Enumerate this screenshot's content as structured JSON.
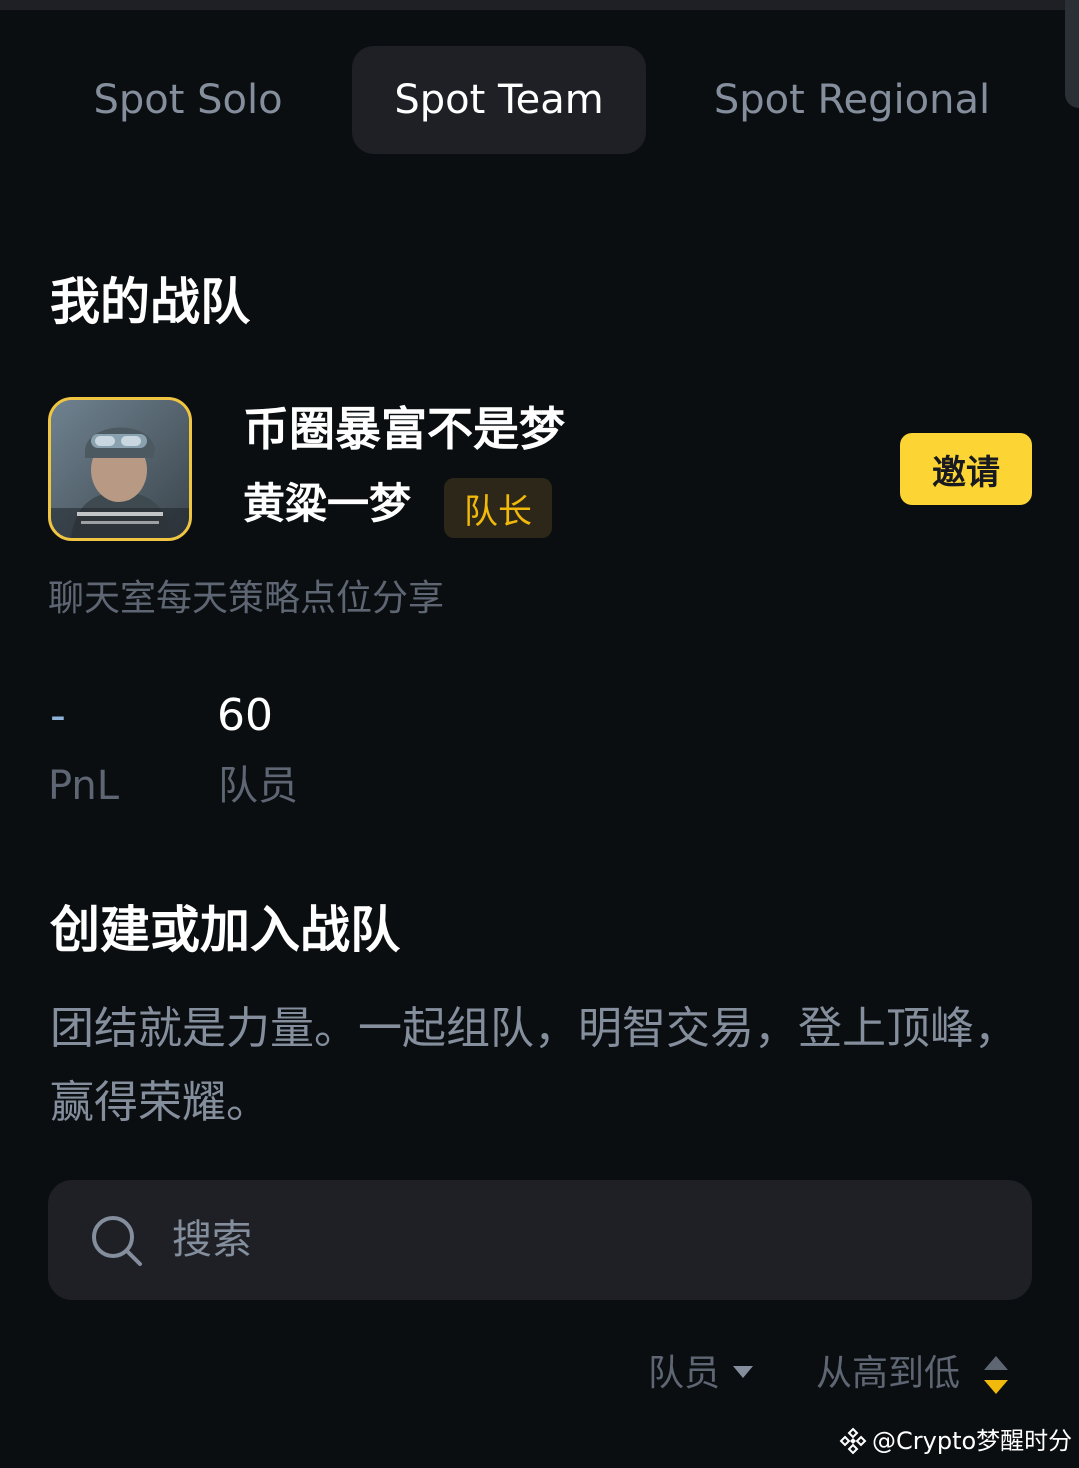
{
  "tabs": [
    {
      "label": "Spot Solo",
      "active": false
    },
    {
      "label": "Spot Team",
      "active": true
    },
    {
      "label": "Spot Regional",
      "active": false
    }
  ],
  "my_team": {
    "section_title": "我的战队",
    "team_name": "币圈暴富不是梦",
    "leader_name": "黄粱一梦",
    "role_badge": "队长",
    "invite_label": "邀请",
    "description": "聊天室每天策略点位分享",
    "stats": {
      "pnl_value": "-",
      "pnl_label": "PnL",
      "members_value": "60",
      "members_label": "队员"
    }
  },
  "create": {
    "section_title": "创建或加入战队",
    "description": "团结就是力量。一起组队，明智交易，登上顶峰，赢得荣耀。"
  },
  "search": {
    "placeholder": "搜索",
    "value": ""
  },
  "sort": {
    "field_label": "队员",
    "order_label": "从高到低"
  },
  "watermark": {
    "text": "@Crypto梦醒时分"
  },
  "colors": {
    "background": "#0b0e11",
    "accent": "#fcd535",
    "badge_text": "#f0b90b",
    "muted": "#848e9c"
  }
}
